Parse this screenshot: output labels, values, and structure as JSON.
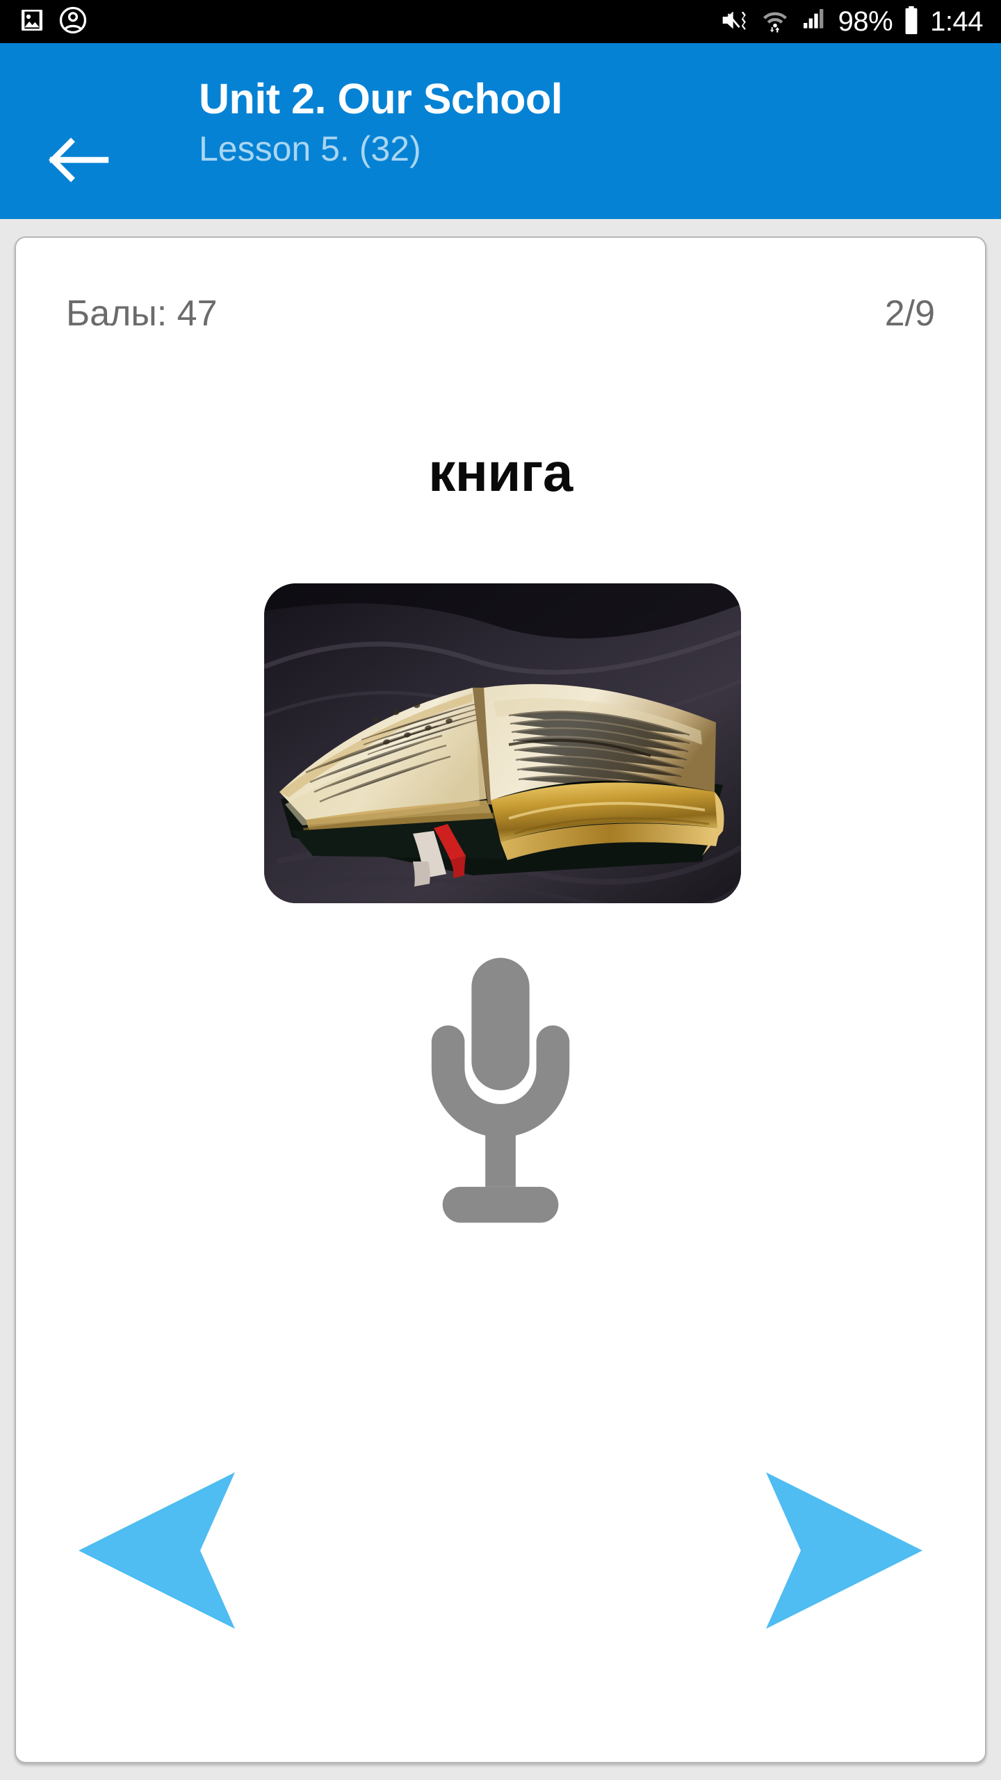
{
  "status_bar": {
    "left_icons": [
      "image-icon",
      "account-circle-icon"
    ],
    "right_icons": [
      "volume-mute-vibrate-icon",
      "wifi-icon",
      "cellular-signal-icon",
      "battery-icon"
    ],
    "battery_percent": "98%",
    "clock": "1:44"
  },
  "app_bar": {
    "back_icon": "back-arrow-icon",
    "title": "Unit 2. Our School",
    "subtitle": "Lesson 5. (32)",
    "background_color": "#0682D4",
    "subtitle_color": "#A9D6F2"
  },
  "card": {
    "score_label": "Балы: 47",
    "progress_label": "2/9",
    "word": "книга",
    "image": {
      "name": "book-photo",
      "alt": "Open old book with gold-edged pages on dark fabric"
    },
    "mic": {
      "icon": "microphone-icon",
      "color": "#8a8a8a"
    },
    "nav": {
      "prev_icon": "arrow-left-icon",
      "next_icon": "arrow-right-icon",
      "color": "#4FBCF2"
    }
  }
}
